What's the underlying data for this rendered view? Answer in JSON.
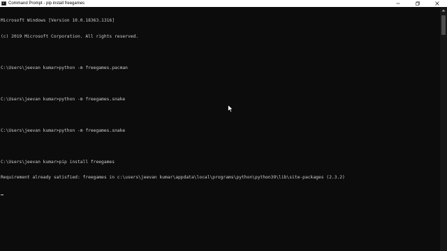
{
  "window": {
    "title": "Command Prompt - pip  install freegames",
    "icon": "cmd-icon"
  },
  "controls": {
    "minimize": "minimize-icon",
    "maximize": "maximize-icon",
    "close": "close-icon"
  },
  "console": {
    "lines": [
      "Microsoft Windows [Version 10.0.18363.1316]",
      "(c) 2019 Microsoft Corporation. All rights reserved.",
      "",
      "C:\\Users\\jeevan kumar>python -m freegames.pacman",
      "",
      "C:\\Users\\jeevan kumar>python -m freegames.snake",
      "",
      "C:\\Users\\jeevan kumar>python -m freegames.snake",
      "",
      "C:\\Users\\jeevan kumar>pip install freegames",
      "Requirement already satisfied: freegames in c:\\users\\jeevan kumar\\appdata\\local\\programs\\python\\python39\\lib\\site-packages (2.3.2)"
    ]
  },
  "colors": {
    "background": "#0c0c0c",
    "text": "#cccccc",
    "titlebar": "#ffffff"
  }
}
